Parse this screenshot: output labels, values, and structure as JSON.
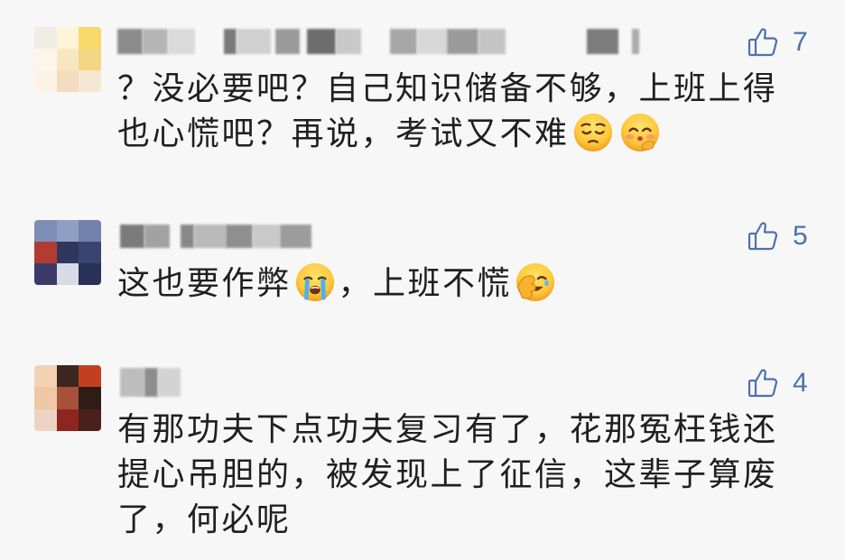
{
  "colors": {
    "background": "#f7f7f7",
    "text": "#1f1f1f",
    "like_accent": "#4d70ad"
  },
  "ui": {
    "like_icon": "thumbs-up"
  },
  "comments": [
    {
      "likes": 7,
      "lines": [
        [
          {
            "text": "？没必要吧？自己知识储备不够，上班上得"
          }
        ],
        [
          {
            "text": "也心慌吧？再说，考试又不难"
          },
          {
            "emoji": "pensive-face"
          },
          {
            "emoji": "snicker-face"
          }
        ]
      ]
    },
    {
      "likes": 5,
      "lines": [
        [
          {
            "text": "这也要作弊"
          },
          {
            "emoji": "crying-face"
          },
          {
            "text": "，上班不慌"
          },
          {
            "emoji": "facepalm-face"
          }
        ]
      ]
    },
    {
      "likes": 4,
      "lines": [
        [
          {
            "text": "有那功夫下点功夫复习有了，花那冤枉钱还"
          }
        ],
        [
          {
            "text": "提心吊胆的，被发现上了征信，这辈子算废"
          }
        ],
        [
          {
            "text": "了，何必呢"
          }
        ]
      ]
    }
  ]
}
